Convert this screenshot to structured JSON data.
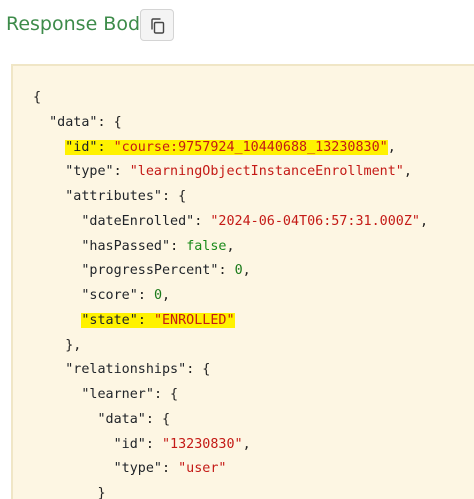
{
  "header": {
    "title": "Response Body",
    "copy_icon": "copy-icon"
  },
  "code": {
    "lines": [
      {
        "indent": "",
        "parts": [
          {
            "t": "p",
            "v": "{"
          }
        ]
      },
      {
        "indent": "  ",
        "parts": [
          {
            "t": "k",
            "v": "\"data\""
          },
          {
            "t": "p",
            "v": ": {"
          }
        ]
      },
      {
        "indent": "    ",
        "highlight": true,
        "parts": [
          {
            "t": "k",
            "v": "\"id\""
          },
          {
            "t": "p",
            "v": ": "
          },
          {
            "t": "s",
            "v": "\"course:9757924_10440688_13230830\""
          }
        ],
        "trail": ","
      },
      {
        "indent": "    ",
        "parts": [
          {
            "t": "k",
            "v": "\"type\""
          },
          {
            "t": "p",
            "v": ": "
          },
          {
            "t": "s",
            "v": "\"learningObjectInstanceEnrollment\""
          },
          {
            "t": "p",
            "v": ","
          }
        ]
      },
      {
        "indent": "    ",
        "parts": [
          {
            "t": "k",
            "v": "\"attributes\""
          },
          {
            "t": "p",
            "v": ": {"
          }
        ]
      },
      {
        "indent": "      ",
        "parts": [
          {
            "t": "k",
            "v": "\"dateEnrolled\""
          },
          {
            "t": "p",
            "v": ": "
          },
          {
            "t": "s",
            "v": "\"2024-06-04T06:57:31.000Z\""
          },
          {
            "t": "p",
            "v": ","
          }
        ]
      },
      {
        "indent": "      ",
        "parts": [
          {
            "t": "k",
            "v": "\"hasPassed\""
          },
          {
            "t": "p",
            "v": ": "
          },
          {
            "t": "b",
            "v": "false"
          },
          {
            "t": "p",
            "v": ","
          }
        ]
      },
      {
        "indent": "      ",
        "parts": [
          {
            "t": "k",
            "v": "\"progressPercent\""
          },
          {
            "t": "p",
            "v": ": "
          },
          {
            "t": "n",
            "v": "0"
          },
          {
            "t": "p",
            "v": ","
          }
        ]
      },
      {
        "indent": "      ",
        "parts": [
          {
            "t": "k",
            "v": "\"score\""
          },
          {
            "t": "p",
            "v": ": "
          },
          {
            "t": "n",
            "v": "0"
          },
          {
            "t": "p",
            "v": ","
          }
        ]
      },
      {
        "indent": "      ",
        "highlight": true,
        "parts": [
          {
            "t": "k",
            "v": "\"state\""
          },
          {
            "t": "p",
            "v": ": "
          },
          {
            "t": "s",
            "v": "\"ENROLLED\""
          }
        ]
      },
      {
        "indent": "    ",
        "parts": [
          {
            "t": "p",
            "v": "},"
          }
        ]
      },
      {
        "indent": "    ",
        "parts": [
          {
            "t": "k",
            "v": "\"relationships\""
          },
          {
            "t": "p",
            "v": ": {"
          }
        ]
      },
      {
        "indent": "      ",
        "parts": [
          {
            "t": "k",
            "v": "\"learner\""
          },
          {
            "t": "p",
            "v": ": {"
          }
        ]
      },
      {
        "indent": "        ",
        "parts": [
          {
            "t": "k",
            "v": "\"data\""
          },
          {
            "t": "p",
            "v": ": {"
          }
        ]
      },
      {
        "indent": "          ",
        "parts": [
          {
            "t": "k",
            "v": "\"id\""
          },
          {
            "t": "p",
            "v": ": "
          },
          {
            "t": "s",
            "v": "\"13230830\""
          },
          {
            "t": "p",
            "v": ","
          }
        ]
      },
      {
        "indent": "          ",
        "parts": [
          {
            "t": "k",
            "v": "\"type\""
          },
          {
            "t": "p",
            "v": ": "
          },
          {
            "t": "s",
            "v": "\"user\""
          }
        ]
      },
      {
        "indent": "        ",
        "parts": [
          {
            "t": "p",
            "v": "}"
          }
        ]
      }
    ]
  },
  "colors": {
    "title": "#3d8b4a",
    "panel_bg": "#fdf6e3",
    "string": "#c41a16",
    "literal": "#1a8a1a",
    "highlight": "#fff200"
  }
}
